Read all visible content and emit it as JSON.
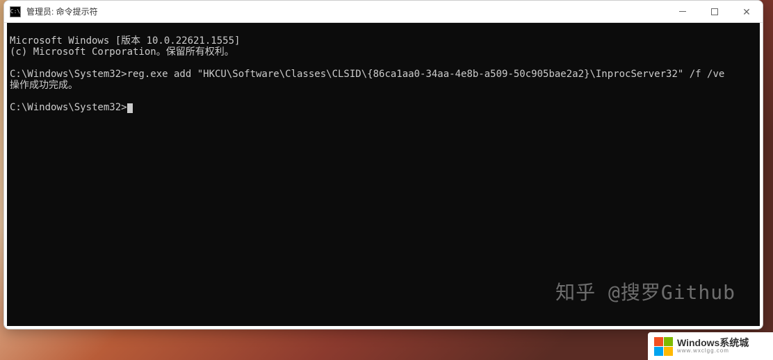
{
  "window": {
    "title": "管理员: 命令提示符"
  },
  "terminal": {
    "line1": "Microsoft Windows [版本 10.0.22621.1555]",
    "line2": "(c) Microsoft Corporation。保留所有权利。",
    "line3": "",
    "line4": "C:\\Windows\\System32>reg.exe add \"HKCU\\Software\\Classes\\CLSID\\{86ca1aa0-34aa-4e8b-a509-50c905bae2a2}\\InprocServer32\" /f /ve",
    "line5": "操作成功完成。",
    "line6": "",
    "line7": "C:\\Windows\\System32>"
  },
  "watermark": {
    "zhihu": "知乎 @搜罗Github",
    "logo_main": "Windows系统城",
    "logo_sub": "www.wxclgg.com"
  },
  "logo_colors": {
    "c1": "#f25022",
    "c2": "#7fba00",
    "c3": "#00a4ef",
    "c4": "#ffb900"
  }
}
